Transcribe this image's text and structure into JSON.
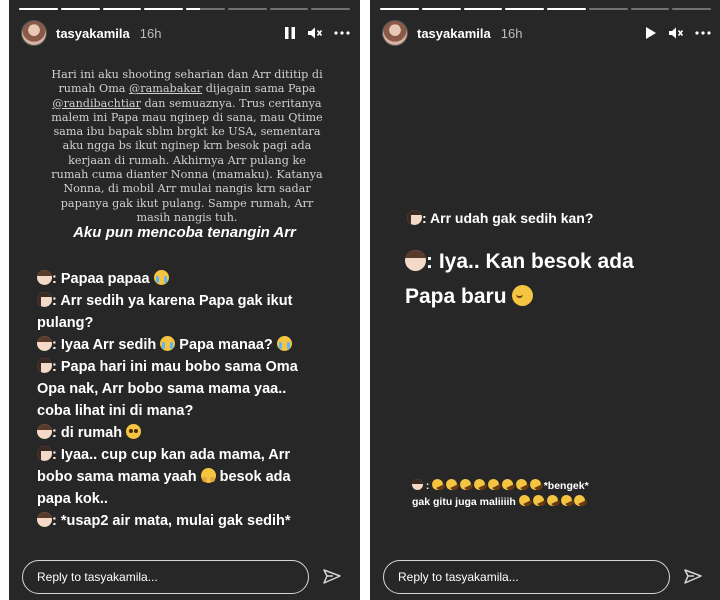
{
  "colors": {
    "story_bg": "#272727",
    "text": "#ffffff",
    "caption_text": "#d0d0d0",
    "meta_text": "#bdbdbd",
    "reply_border": "#d5d5d5"
  },
  "stories": [
    {
      "username": "tasyakamila",
      "time": "16h",
      "progress": [
        1,
        1,
        1,
        1,
        0.35,
        0,
        0,
        0
      ],
      "controls": {
        "playback": "pause-icon",
        "sound": "muted-speaker-icon",
        "more": "more-icon"
      },
      "caption": {
        "p1": "Hari ini aku shooting seharian dan Arr dititip di rumah Oma ",
        "m1": "@ramabakar",
        "p2": " dijagain sama Papa ",
        "m2": "@randibachtiar",
        "p3": " dan semuaznya. Trus ceritanya malem ini Papa mau nginep di sana, mau Qtime sama ibu bapak sblm brgkt ke USA, sementara aku ngga bs ikut nginep krn besok pagi ada kerjaan di rumah. Akhirnya Arr pulang ke rumah cuma dianter Nonna (mamaku). Katanya Nonna, di mobil Arr mulai nangis krn sadar papanya gak ikut pulang. Sampe rumah, Arr masih nangis tuh."
      },
      "headline": "Aku pun mencoba tenangin Arr",
      "chat": {
        "l1": ": Papaa papaa",
        "l2": ": Arr sedih ya karena Papa gak ikut",
        "l3": "pulang?",
        "l4a": ": Iyaa Arr sedih",
        "l4b": "Papa manaa?",
        "l5": ": Papa hari ini mau bobo sama Oma",
        "l6": "Opa nak, Arr bobo sama mama yaa..",
        "l7": "coba lihat ini di mana?",
        "l8": ": di rumah",
        "l9": ": Iyaa.. cup cup kan ada mama, Arr",
        "l10a": "bobo sama mama yaah",
        "l10b": "besok ada",
        "l11": "papa kok..",
        "l12": ": *usap2 air mata, mulai gak sedih*"
      },
      "reply_placeholder": "Reply to tasyakamila...",
      "send_icon": "send-icon"
    },
    {
      "username": "tasyakamila",
      "time": "16h",
      "progress": [
        1,
        1,
        1,
        1,
        1,
        0,
        0,
        0
      ],
      "controls": {
        "playback": "play-icon",
        "sound": "muted-speaker-icon",
        "more": "more-icon"
      },
      "question": ": Arr udah gak sedih kan?",
      "answer_l1": ": Iya.. Kan besok ada",
      "answer_l2": "Papa baru",
      "reply_tag": "*bengek*",
      "reply_l2": "gak gitu juga maliiiih",
      "reply_placeholder": "Reply to tasyakamila...",
      "send_icon": "send-icon"
    }
  ]
}
